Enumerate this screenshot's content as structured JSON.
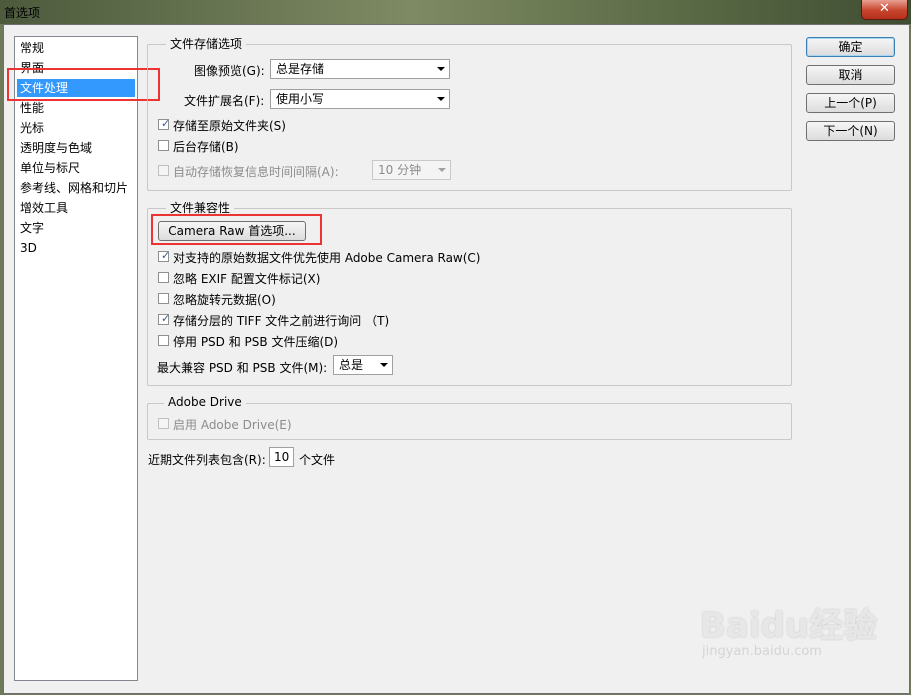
{
  "window": {
    "title": "首选项",
    "close_glyph": "✕"
  },
  "nav": {
    "items": [
      "常规",
      "界面",
      "文件处理",
      "性能",
      "光标",
      "透明度与色域",
      "单位与标尺",
      "参考线、网格和切片",
      "增效工具",
      "文字",
      "3D"
    ],
    "selected_index": 2
  },
  "file_saving": {
    "title": "文件存储选项",
    "image_preview_label": "图像预览(G):",
    "image_preview_value": "总是存储",
    "extension_label": "文件扩展名(F):",
    "extension_value": "使用小写",
    "save_to_original_label": "存储至原始文件夹(S)",
    "save_to_original_checked": true,
    "background_save_label": "后台存储(B)",
    "background_save_checked": false,
    "autosave_label": "自动存储恢复信息时间间隔(A):",
    "autosave_checked": false,
    "autosave_value": "10 分钟"
  },
  "compatibility": {
    "title": "文件兼容性",
    "camera_raw_button": "Camera Raw 首选项...",
    "prefer_camera_raw_label": "对支持的原始数据文件优先使用 Adobe Camera Raw(C)",
    "prefer_camera_raw_checked": true,
    "ignore_exif_label": "忽略 EXIF 配置文件标记(X)",
    "ignore_exif_checked": false,
    "ignore_rotation_label": "忽略旋转元数据(O)",
    "ignore_rotation_checked": false,
    "ask_tiff_label": "存储分层的 TIFF 文件之前进行询问 （T)",
    "ask_tiff_checked": true,
    "disable_compression_label": "停用 PSD 和 PSB 文件压缩(D)",
    "disable_compression_checked": false,
    "maximize_label": "最大兼容 PSD 和 PSB 文件(M):",
    "maximize_value": "总是"
  },
  "adobe_drive": {
    "title": "Adobe Drive",
    "enable_label": "启用 Adobe Drive(E)",
    "enable_checked": false
  },
  "recent_files": {
    "label": "近期文件列表包含(R):",
    "value": "10",
    "suffix": "个文件"
  },
  "buttons": {
    "ok": "确定",
    "cancel": "取消",
    "prev": "上一个(P)",
    "next": "下一个(N)"
  },
  "watermark": {
    "logo": "Baidu经验",
    "url": "jingyan.baidu.com"
  },
  "colors": {
    "selection": "#3399ff",
    "highlight": "#e33333"
  }
}
